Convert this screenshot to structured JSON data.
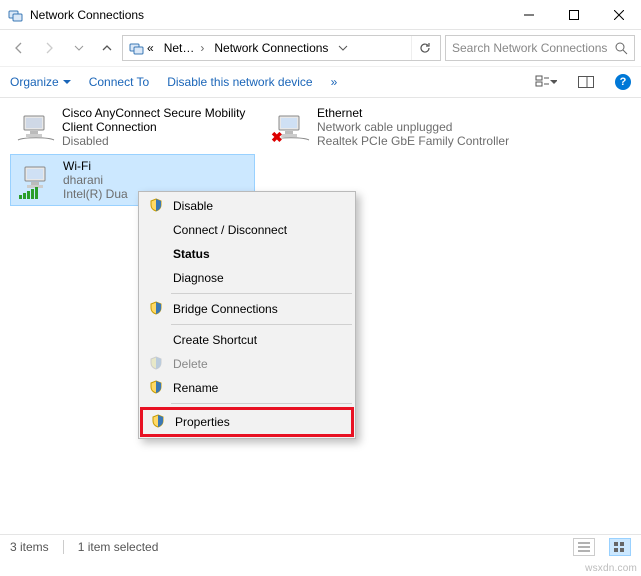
{
  "window": {
    "title": "Network Connections"
  },
  "breadcrumb": {
    "root": "Net…",
    "current": "Network Connections",
    "dropdown_glyph": "›"
  },
  "search": {
    "placeholder": "Search Network Connections"
  },
  "commands": {
    "organize": "Organize",
    "connect_to": "Connect To",
    "disable_device": "Disable this network device",
    "more": "»"
  },
  "connections": {
    "cisco": {
      "name": "Cisco AnyConnect Secure Mobility Client Connection",
      "status": "Disabled"
    },
    "ethernet": {
      "name": "Ethernet",
      "status": "Network cable unplugged",
      "device": "Realtek PCIe GbE Family Controller"
    },
    "wifi": {
      "name": "Wi-Fi",
      "status": "dharani",
      "device": "Intel(R) Dua"
    }
  },
  "context_menu": {
    "disable": "Disable",
    "connect": "Connect / Disconnect",
    "status": "Status",
    "diagnose": "Diagnose",
    "bridge": "Bridge Connections",
    "shortcut": "Create Shortcut",
    "delete": "Delete",
    "rename": "Rename",
    "properties": "Properties"
  },
  "statusbar": {
    "items": "3 items",
    "selected": "1 item selected"
  },
  "watermark": "wsxdn.com"
}
